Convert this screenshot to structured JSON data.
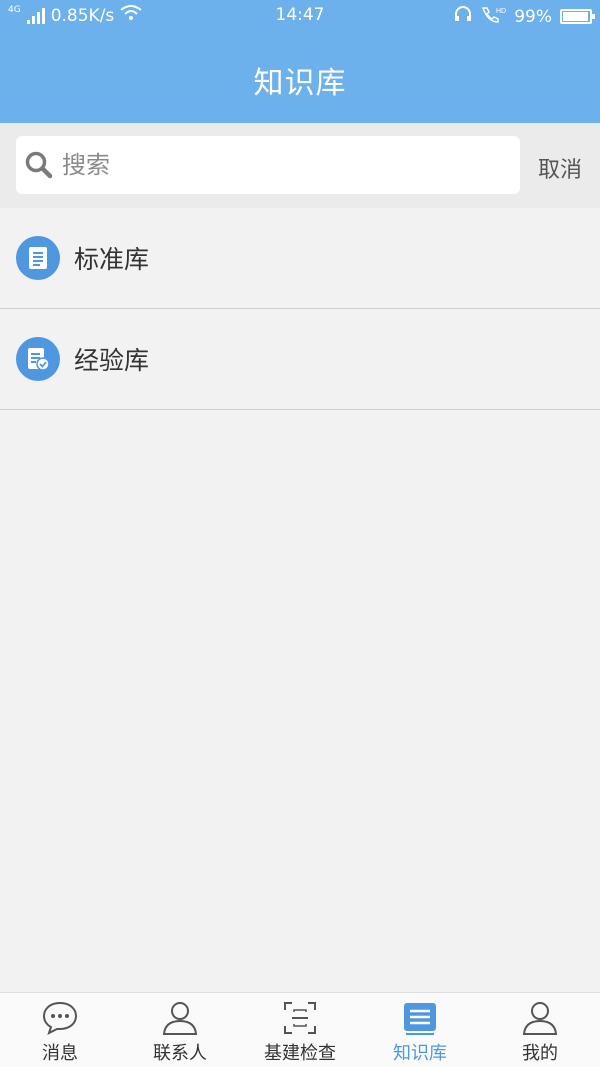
{
  "status_bar": {
    "network": "4G",
    "speed": "0.85K/s",
    "time": "14:47",
    "battery": "99%"
  },
  "header": {
    "title": "知识库"
  },
  "search": {
    "placeholder": "搜索",
    "cancel_label": "取消"
  },
  "list": [
    {
      "label": "标准库",
      "icon": "document-icon"
    },
    {
      "label": "经验库",
      "icon": "checked-document-icon"
    }
  ],
  "tabbar": [
    {
      "label": "消息",
      "icon": "chat-bubble-icon",
      "active": false
    },
    {
      "label": "联系人",
      "icon": "person-icon",
      "active": false
    },
    {
      "label": "基建检查",
      "icon": "scan-icon",
      "active": false
    },
    {
      "label": "知识库",
      "icon": "list-icon",
      "active": true
    },
    {
      "label": "我的",
      "icon": "user-icon",
      "active": false
    }
  ],
  "colors": {
    "header": "#6cb0ec",
    "accent": "#4f98e0",
    "background": "#f2f2f2"
  }
}
